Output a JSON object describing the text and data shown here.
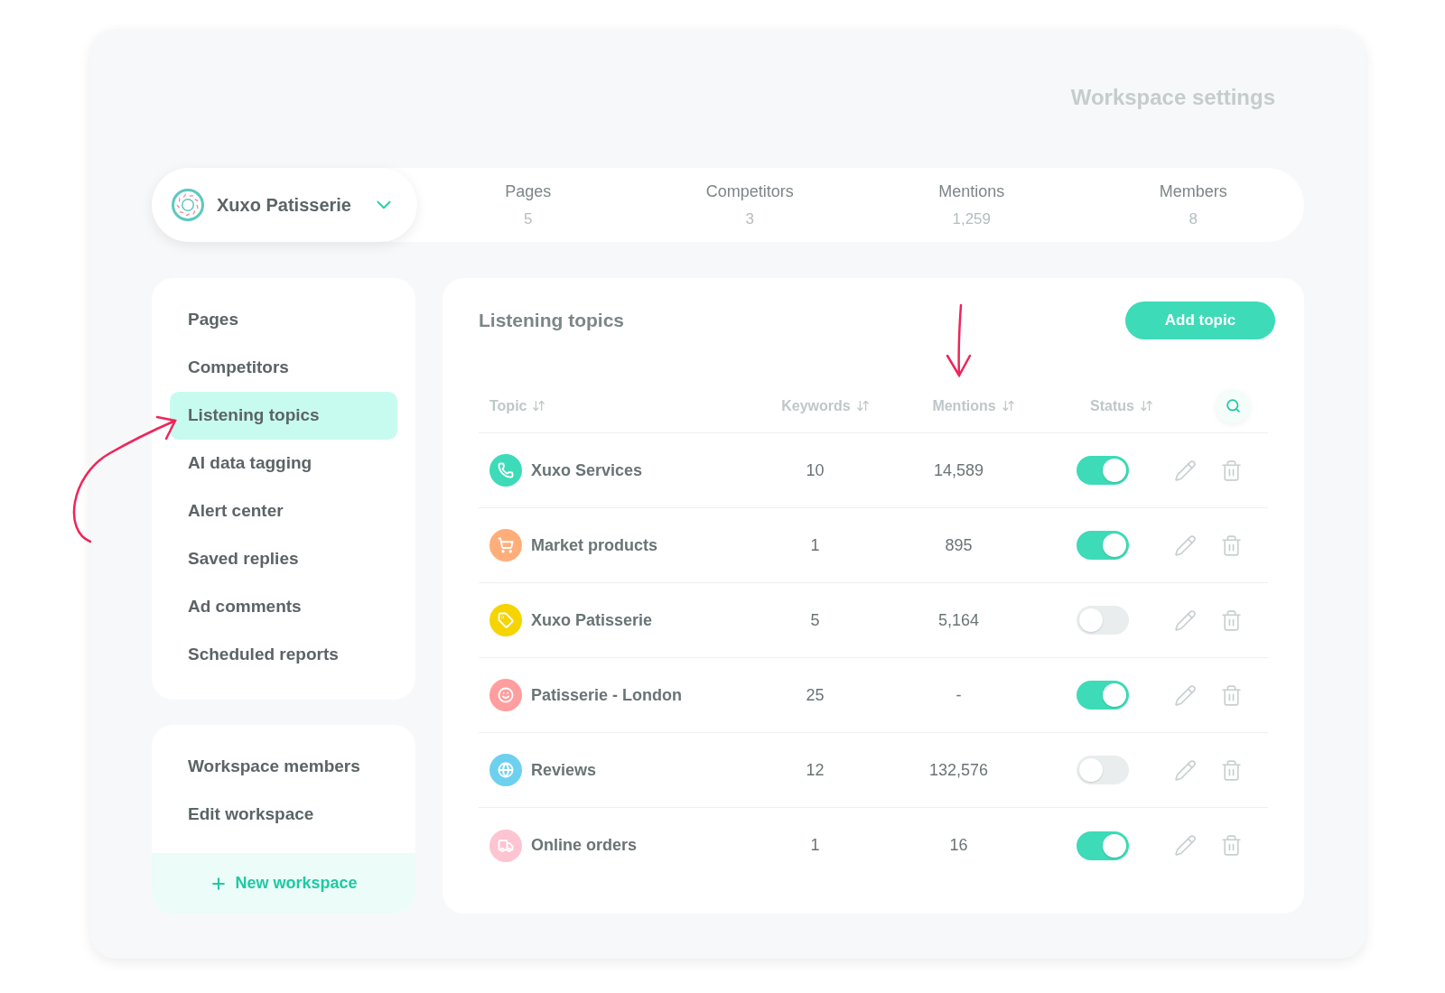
{
  "title": "Workspace settings",
  "workspace": {
    "name": "Xuxo Patisserie"
  },
  "stats": [
    {
      "label": "Pages",
      "value": "5"
    },
    {
      "label": "Competitors",
      "value": "3"
    },
    {
      "label": "Mentions",
      "value": "1,259"
    },
    {
      "label": "Members",
      "value": "8"
    }
  ],
  "sidebar": {
    "items": [
      {
        "label": "Pages",
        "selected": false
      },
      {
        "label": "Competitors",
        "selected": false
      },
      {
        "label": "Listening topics",
        "selected": true
      },
      {
        "label": "AI data tagging",
        "selected": false
      },
      {
        "label": "Alert center",
        "selected": false
      },
      {
        "label": "Saved replies",
        "selected": false
      },
      {
        "label": "Ad comments",
        "selected": false
      },
      {
        "label": "Scheduled reports",
        "selected": false
      }
    ]
  },
  "workspace_menu": {
    "items": [
      {
        "label": "Workspace members"
      },
      {
        "label": "Edit workspace"
      }
    ],
    "new_button": "New workspace"
  },
  "panel": {
    "title": "Listening topics",
    "add_button": "Add topic",
    "columns": [
      "Topic",
      "Keywords",
      "Mentions",
      "Status"
    ],
    "rows": [
      {
        "kind": "phone",
        "color": "#3ddbb8",
        "topic": "Xuxo Services",
        "keywords": "10",
        "mentions": "14,589",
        "on": true
      },
      {
        "kind": "cart",
        "color": "#ffae7a",
        "topic": "Market products",
        "keywords": "1",
        "mentions": "895",
        "on": true
      },
      {
        "kind": "tag",
        "color": "#f5d400",
        "topic": "Xuxo Patisserie",
        "keywords": "5",
        "mentions": "5,164",
        "on": false
      },
      {
        "kind": "smile",
        "color": "#ff9e9e",
        "topic": "Patisserie - London",
        "keywords": "25",
        "mentions": "-",
        "on": true
      },
      {
        "kind": "globe",
        "color": "#6dd0ee",
        "topic": "Reviews",
        "keywords": "12",
        "mentions": "132,576",
        "on": false
      },
      {
        "kind": "truck",
        "color": "#ffc4d1",
        "topic": "Online orders",
        "keywords": "1",
        "mentions": "16",
        "on": true
      }
    ]
  }
}
